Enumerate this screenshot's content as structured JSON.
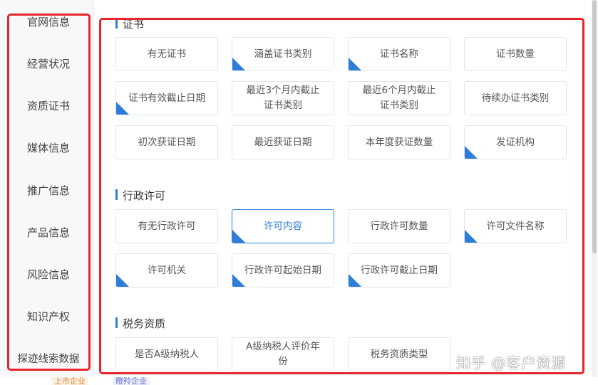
{
  "sidebar": {
    "items": [
      {
        "label": "官网信息"
      },
      {
        "label": "经营状况"
      },
      {
        "label": "资质证书"
      },
      {
        "label": "媒体信息"
      },
      {
        "label": "推广信息"
      },
      {
        "label": "产品信息"
      },
      {
        "label": "风险信息"
      },
      {
        "label": "知识产权"
      },
      {
        "label": "探迹线索数据"
      }
    ]
  },
  "sections": {
    "certificate": {
      "title": "证书",
      "tags": [
        {
          "label": "有无证书",
          "corner": false
        },
        {
          "label": "涵盖证书类别",
          "corner": true
        },
        {
          "label": "证书名称",
          "corner": true
        },
        {
          "label": "证书数量",
          "corner": false
        },
        {
          "label": "证书有效截止日期",
          "corner": true
        },
        {
          "label": "最近3个月内截止证书类别",
          "corner": false
        },
        {
          "label": "最近6个月内截止证书类别",
          "corner": false
        },
        {
          "label": "待续办证书类别",
          "corner": false
        },
        {
          "label": "初次获证日期",
          "corner": false
        },
        {
          "label": "最近获证日期",
          "corner": false
        },
        {
          "label": "本年度获证数量",
          "corner": false
        },
        {
          "label": "发证机构",
          "corner": true
        }
      ]
    },
    "license": {
      "title": "行政许可",
      "tags": [
        {
          "label": "有无行政许可",
          "corner": false
        },
        {
          "label": "许可内容",
          "corner": true,
          "active": true
        },
        {
          "label": "行政许可数量",
          "corner": false
        },
        {
          "label": "许可文件名称",
          "corner": true
        },
        {
          "label": "许可机关",
          "corner": true
        },
        {
          "label": "行政许可起始日期",
          "corner": true
        },
        {
          "label": "行政许可截止日期",
          "corner": true
        }
      ]
    },
    "tax": {
      "title": "税务资质",
      "tags": [
        {
          "label": "是否A级纳税人",
          "corner": false
        },
        {
          "label": "A级纳税人评价年份",
          "corner": false
        },
        {
          "label": "税务资质类型",
          "corner": false
        }
      ]
    }
  },
  "bottom": {
    "tag1": "上市企业",
    "tag2": "瞪羚企业"
  },
  "watermark": "知乎 @客户资源",
  "colors": {
    "accent": "#2e7ed8",
    "highlight_box": "#e8232a",
    "sidebar_bg": "#f7f8fa"
  }
}
